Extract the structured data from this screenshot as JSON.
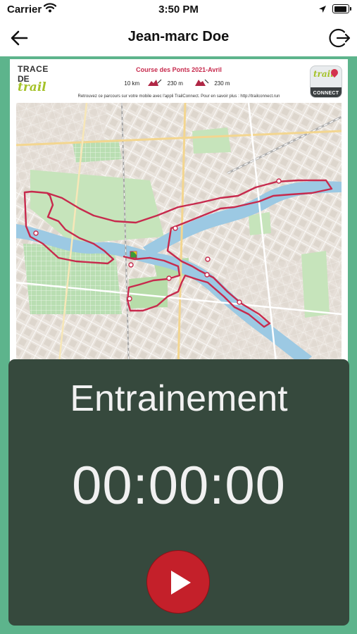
{
  "status_bar": {
    "carrier": "Carrier",
    "time": "3:50 PM",
    "icons": [
      "wifi-icon",
      "location-arrow-icon",
      "battery-icon"
    ]
  },
  "nav": {
    "title": "Jean-marc Doe",
    "back_icon": "arrow-left-icon",
    "logout_icon": "logout-icon"
  },
  "map": {
    "brand": {
      "line1": "TRACE",
      "line2": "DE",
      "line3": "trail"
    },
    "race_title": "Course des Ponts 2021-Avril",
    "distance": "10 km",
    "elevation_gain": "230 m",
    "elevation_loss": "230 m",
    "note": "Retrouvez ce parcours sur votre mobile avec l'appli TrailConnect. Pour en savoir plus : http://trailconnect.run",
    "logo": {
      "top": "trail",
      "bottom": "CONNECT"
    }
  },
  "timer": {
    "mode": "Entrainement",
    "elapsed": "00:00:00",
    "play_icon": "play-icon"
  },
  "colors": {
    "background_green": "#5db48c",
    "panel": "#36493d",
    "play_button": "#c4202a",
    "route": "#c72a4d",
    "river": "#8fc6dd"
  }
}
